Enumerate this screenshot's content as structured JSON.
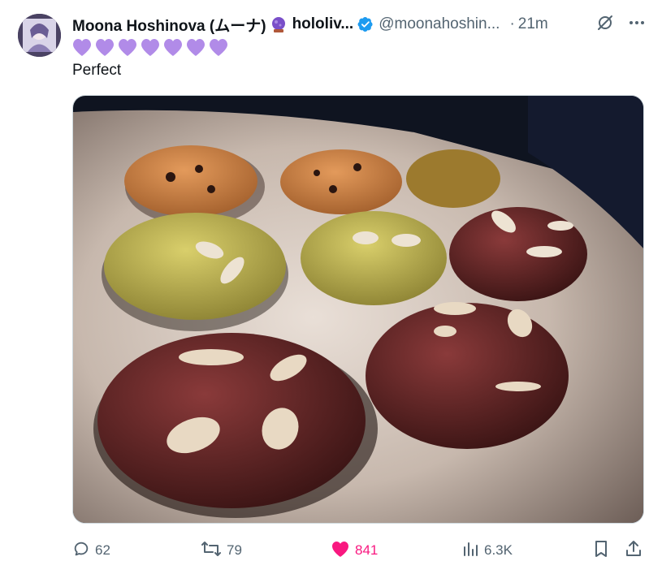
{
  "post": {
    "display_name": "Moona Hoshinova (ムーナ)",
    "affiliation": "hololiv...",
    "handle": "@moonahoshin...",
    "separator": "·",
    "time": "21m",
    "emoji_hearts": [
      "💜",
      "💜",
      "💜",
      "💜",
      "💜",
      "💜",
      "💜"
    ],
    "text": "Perfect",
    "media_description_icon": "photo"
  },
  "actions": {
    "replies": "62",
    "reposts": "79",
    "likes": "841",
    "views": "6.3K",
    "liked": true
  },
  "colors": {
    "text": "#0f1419",
    "secondary": "#536471",
    "verified": "#1d9bf0",
    "like": "#f91880",
    "heart_purple": "#b18be8"
  },
  "icons": [
    "grok-icon",
    "more-icon",
    "reply-icon",
    "repost-icon",
    "like-icon",
    "views-icon",
    "bookmark-icon",
    "share-icon",
    "verified-icon"
  ]
}
